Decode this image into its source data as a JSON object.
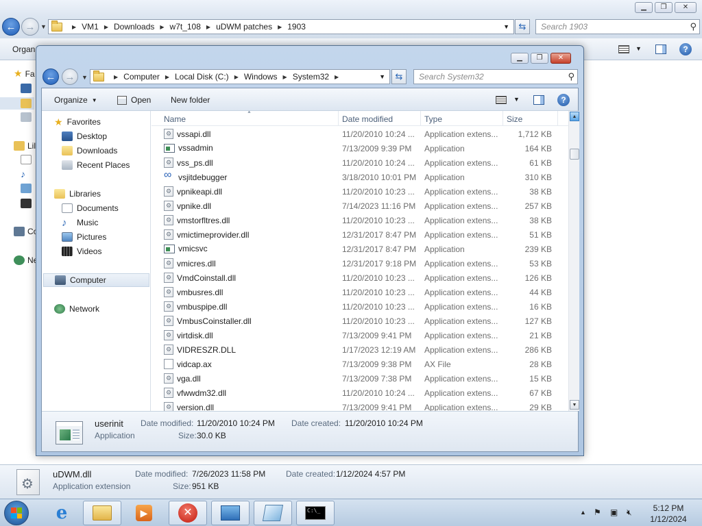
{
  "background_window": {
    "address_crumbs": [
      "VM1",
      "Downloads",
      "w7t_108",
      "uDWM patches",
      "1903"
    ],
    "search_placeholder": "Search 1903",
    "organize_label": "Organ",
    "nav_fragments": [
      "Fa",
      "Lil",
      "Co",
      "Ne"
    ],
    "details": {
      "filename": "uDWM.dll",
      "type": "Application extension",
      "modified_label": "Date modified:",
      "modified_value": "7/26/2023 11:58 PM",
      "created_label": "Date created:",
      "created_value": "1/12/2024 4:57 PM",
      "size_label": "Size:",
      "size_value": "951 KB"
    }
  },
  "window": {
    "address_crumbs": [
      "Computer",
      "Local Disk (C:)",
      "Windows",
      "System32"
    ],
    "search_placeholder": "Search System32",
    "toolbar": {
      "organize_label": "Organize",
      "open_label": "Open",
      "new_folder_label": "New folder"
    },
    "nav": {
      "favorites": "Favorites",
      "desktop": "Desktop",
      "downloads": "Downloads",
      "recent_places": "Recent Places",
      "libraries": "Libraries",
      "documents": "Documents",
      "music": "Music",
      "pictures": "Pictures",
      "videos": "Videos",
      "computer": "Computer",
      "network": "Network"
    },
    "columns": {
      "name": "Name",
      "date_modified": "Date modified",
      "type": "Type",
      "size": "Size"
    },
    "files": [
      {
        "name": "vssapi.dll",
        "date": "11/20/2010 10:24 ...",
        "type": "Application extens...",
        "size": "1,712 KB",
        "icon": "dll"
      },
      {
        "name": "vssadmin",
        "date": "7/13/2009 9:39 PM",
        "type": "Application",
        "size": "164 KB",
        "icon": "app"
      },
      {
        "name": "vss_ps.dll",
        "date": "11/20/2010 10:24 ...",
        "type": "Application extens...",
        "size": "61 KB",
        "icon": "dll"
      },
      {
        "name": "vsjitdebugger",
        "date": "3/18/2010 10:01 PM",
        "type": "Application",
        "size": "310 KB",
        "icon": "inf"
      },
      {
        "name": "vpnikeapi.dll",
        "date": "11/20/2010 10:23 ...",
        "type": "Application extens...",
        "size": "38 KB",
        "icon": "dll"
      },
      {
        "name": "vpnike.dll",
        "date": "7/14/2023 11:16 PM",
        "type": "Application extens...",
        "size": "257 KB",
        "icon": "dll"
      },
      {
        "name": "vmstorfltres.dll",
        "date": "11/20/2010 10:23 ...",
        "type": "Application extens...",
        "size": "38 KB",
        "icon": "dll"
      },
      {
        "name": "vmictimeprovider.dll",
        "date": "12/31/2017 8:47 PM",
        "type": "Application extens...",
        "size": "51 KB",
        "icon": "dll"
      },
      {
        "name": "vmicsvc",
        "date": "12/31/2017 8:47 PM",
        "type": "Application",
        "size": "239 KB",
        "icon": "app"
      },
      {
        "name": "vmicres.dll",
        "date": "12/31/2017 9:18 PM",
        "type": "Application extens...",
        "size": "53 KB",
        "icon": "dll"
      },
      {
        "name": "VmdCoinstall.dll",
        "date": "11/20/2010 10:23 ...",
        "type": "Application extens...",
        "size": "126 KB",
        "icon": "dll"
      },
      {
        "name": "vmbusres.dll",
        "date": "11/20/2010 10:23 ...",
        "type": "Application extens...",
        "size": "44 KB",
        "icon": "dll"
      },
      {
        "name": "vmbuspipe.dll",
        "date": "11/20/2010 10:23 ...",
        "type": "Application extens...",
        "size": "16 KB",
        "icon": "dll"
      },
      {
        "name": "VmbusCoinstaller.dll",
        "date": "11/20/2010 10:23 ...",
        "type": "Application extens...",
        "size": "127 KB",
        "icon": "dll"
      },
      {
        "name": "virtdisk.dll",
        "date": "7/13/2009 9:41 PM",
        "type": "Application extens...",
        "size": "21 KB",
        "icon": "dll"
      },
      {
        "name": "VIDRESZR.DLL",
        "date": "1/17/2023 12:19 AM",
        "type": "Application extens...",
        "size": "286 KB",
        "icon": "dll"
      },
      {
        "name": "vidcap.ax",
        "date": "7/13/2009 9:38 PM",
        "type": "AX File",
        "size": "28 KB",
        "icon": "ax"
      },
      {
        "name": "vga.dll",
        "date": "7/13/2009 7:38 PM",
        "type": "Application extens...",
        "size": "15 KB",
        "icon": "dll"
      },
      {
        "name": "vfwwdm32.dll",
        "date": "11/20/2010 10:24 ...",
        "type": "Application extens...",
        "size": "67 KB",
        "icon": "dll"
      },
      {
        "name": "version.dll",
        "date": "7/13/2009 9:41 PM",
        "type": "Application extens...",
        "size": "29 KB",
        "icon": "dll"
      }
    ],
    "details": {
      "filename": "userinit",
      "type": "Application",
      "modified_label": "Date modified:",
      "modified_value": "11/20/2010 10:24 PM",
      "created_label": "Date created:",
      "created_value": "11/20/2010 10:24 PM",
      "size_label": "Size:",
      "size_value": "30.0 KB"
    }
  },
  "taskbar": {
    "time": "5:12 PM",
    "date": "1/12/2024"
  },
  "colors": {
    "accent_blue": "#2a66b6",
    "close_red": "#c6402a",
    "glass_frame": "#b9cfe8"
  }
}
